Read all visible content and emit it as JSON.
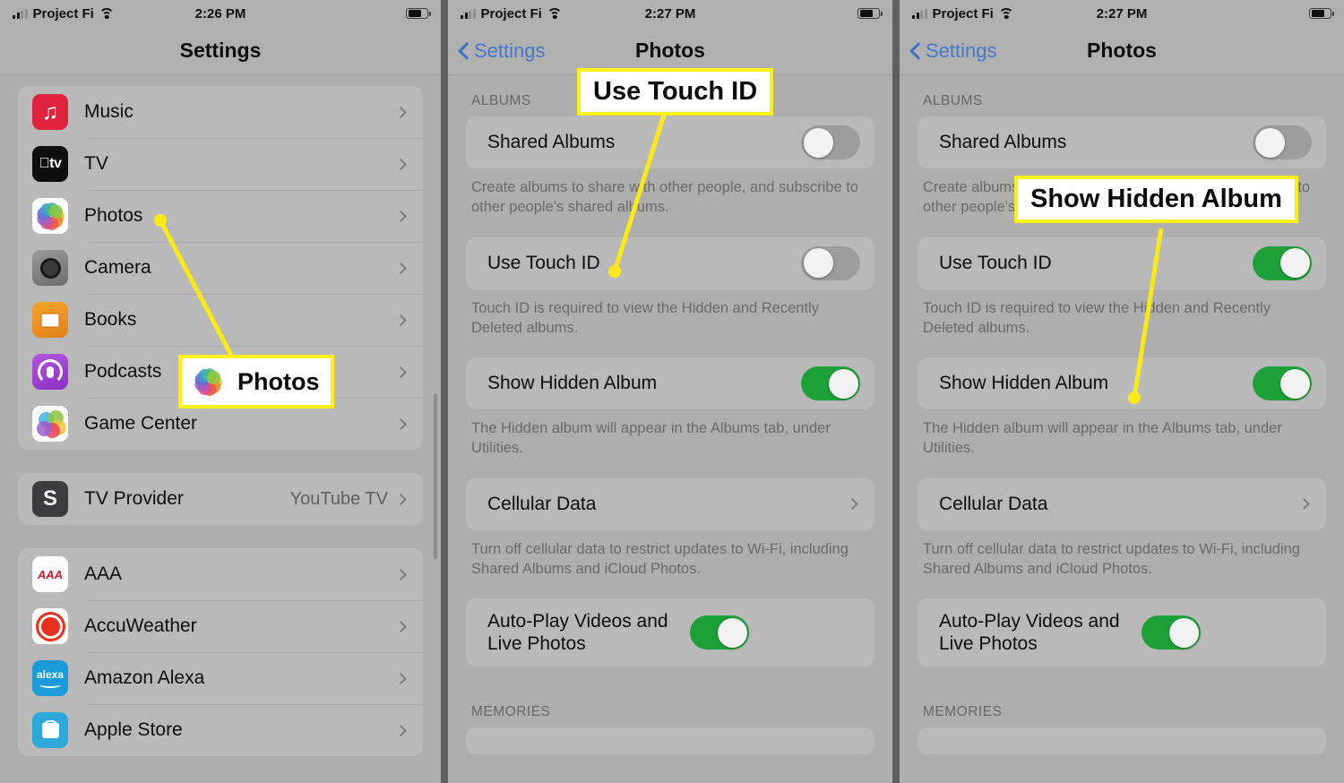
{
  "panels": [
    {
      "id": "settings-list",
      "status": {
        "carrier": "Project Fi",
        "time": "2:26 PM",
        "signal_bars_filled": 2,
        "signal_bars_total": 4,
        "wifi": true,
        "battery_percent": 72
      },
      "nav": {
        "title": "Settings",
        "back": null
      },
      "groups": [
        {
          "header": null,
          "rows": [
            {
              "icon": "music-icon",
              "label": "Music",
              "accessory": "chevron"
            },
            {
              "icon": "tv-icon",
              "label": "TV",
              "accessory": "chevron"
            },
            {
              "icon": "photos-icon",
              "label": "Photos",
              "accessory": "chevron"
            },
            {
              "icon": "camera-icon",
              "label": "Camera",
              "accessory": "chevron"
            },
            {
              "icon": "books-icon",
              "label": "Books",
              "accessory": "chevron"
            },
            {
              "icon": "podcasts-icon",
              "label": "Podcasts",
              "accessory": "chevron"
            },
            {
              "icon": "game-center-icon",
              "label": "Game Center",
              "accessory": "chevron"
            }
          ]
        },
        {
          "header": null,
          "rows": [
            {
              "icon": "tv-provider-icon",
              "label": "TV Provider",
              "value": "YouTube TV",
              "accessory": "chevron"
            }
          ]
        },
        {
          "header": null,
          "rows": [
            {
              "icon": "aaa-icon",
              "label": "AAA",
              "accessory": "chevron"
            },
            {
              "icon": "accuweather-icon",
              "label": "AccuWeather",
              "accessory": "chevron"
            },
            {
              "icon": "amazon-alexa-icon",
              "label": "Amazon Alexa",
              "accessory": "chevron"
            },
            {
              "icon": "apple-store-icon",
              "label": "Apple Store",
              "accessory": "chevron"
            }
          ]
        }
      ],
      "callout": {
        "text": "Photos",
        "icon": "photos-icon"
      }
    },
    {
      "id": "photos-settings-before",
      "status": {
        "carrier": "Project Fi",
        "time": "2:27 PM",
        "signal_bars_filled": 2,
        "signal_bars_total": 4,
        "wifi": true,
        "battery_percent": 72
      },
      "nav": {
        "title": "Photos",
        "back": "Settings"
      },
      "section_header": "ALBUMS",
      "rows": [
        {
          "label": "Shared Albums",
          "type": "toggle",
          "value": "off",
          "footer": "Create albums to share with other people, and subscribe to other people's shared albums."
        },
        {
          "label": "Use Touch ID",
          "type": "toggle",
          "value": "off",
          "footer": "Touch ID is required to view the Hidden and Recently Deleted albums."
        },
        {
          "label": "Show Hidden Album",
          "type": "toggle",
          "value": "on",
          "footer": "The Hidden album will appear in the Albums tab, under Utilities."
        },
        {
          "label": "Cellular Data",
          "type": "chevron",
          "footer": "Turn off cellular data to restrict updates to Wi-Fi, including Shared Albums and iCloud Photos."
        },
        {
          "label": "Auto-Play Videos and Live Photos",
          "type": "toggle",
          "value": "on",
          "footer": null
        }
      ],
      "bottom_header": "MEMORIES",
      "callout": {
        "text": "Use Touch ID"
      }
    },
    {
      "id": "photos-settings-after",
      "status": {
        "carrier": "Project Fi",
        "time": "2:27 PM",
        "signal_bars_filled": 2,
        "signal_bars_total": 4,
        "wifi": true,
        "battery_percent": 72
      },
      "nav": {
        "title": "Photos",
        "back": "Settings"
      },
      "section_header": "ALBUMS",
      "rows": [
        {
          "label": "Shared Albums",
          "type": "toggle",
          "value": "off",
          "footer": "Create albums to share with other people, and subscribe to other people's shared albums."
        },
        {
          "label": "Use Touch ID",
          "type": "toggle",
          "value": "on",
          "footer": "Touch ID is required to view the Hidden and Recently Deleted albums."
        },
        {
          "label": "Show Hidden Album",
          "type": "toggle",
          "value": "on",
          "footer": "The Hidden album will appear in the Albums tab, under Utilities."
        },
        {
          "label": "Cellular Data",
          "type": "chevron",
          "footer": "Turn off cellular data to restrict updates to Wi-Fi, including Shared Albums and iCloud Photos."
        },
        {
          "label": "Auto-Play Videos and Live Photos",
          "type": "toggle",
          "value": "on",
          "footer": null
        }
      ],
      "bottom_header": "MEMORIES",
      "callout": {
        "text": "Show Hidden Album"
      }
    }
  ],
  "colors": {
    "highlight": "#FBF018",
    "toggle_on": "#1DA038",
    "toggle_off": "#9D9D9D",
    "link": "#4579C9"
  }
}
